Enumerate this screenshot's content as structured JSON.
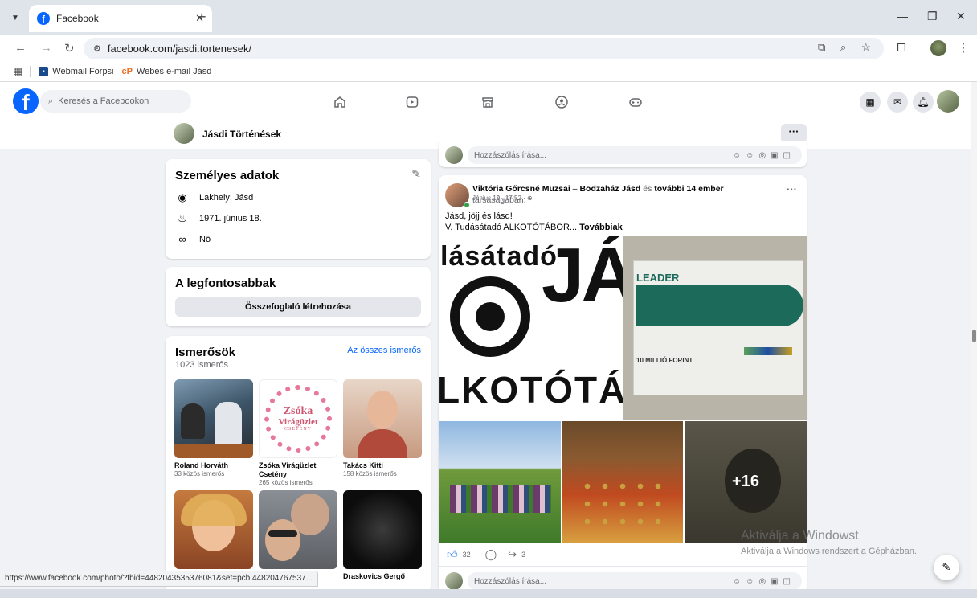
{
  "browser": {
    "tab_title": "Facebook",
    "url": "facebook.com/jasdi.tortenesek/",
    "bookmarks": [
      {
        "label": "Webmail Forpsi"
      },
      {
        "label": "Webes e-mail Jásd"
      }
    ],
    "status_url": "https://www.facebook.com/photo/?fbid=448204353537608​1&set=pcb.448204767537..."
  },
  "fb": {
    "search_placeholder": "Keresés a Facebookon"
  },
  "page": {
    "name": "Jásdi Történések"
  },
  "about": {
    "title": "Személyes adatok",
    "residence": "Lakhely: Jásd",
    "birthday": "1971. június 18.",
    "gender": "Nő"
  },
  "featured": {
    "title": "A legfontosabbak",
    "button": "Összefoglaló létrehozása"
  },
  "friends": {
    "title": "Ismerősök",
    "count": "1023 ismerős",
    "see_all": "Az összes ismerős",
    "items": [
      {
        "name": "Roland Horváth",
        "mutual": "33 közös ismerős"
      },
      {
        "name": "Zsóka Virágüzlet Csetény",
        "mutual": "265 közös ismerős"
      },
      {
        "name": "Takács Kitti",
        "mutual": "158 közös ismerős"
      },
      {
        "name": "",
        "mutual": ""
      },
      {
        "name": "",
        "mutual": ""
      },
      {
        "name": "Draskovics Gergő",
        "mutual": ""
      }
    ],
    "flower_logo_top": "Zsóka",
    "flower_logo_mid": "Virágüzlet",
    "flower_logo_bottom": "CSETÉNY"
  },
  "post": {
    "author": "Viktória Gőrcsné Muzsai",
    "with_sep": " – ",
    "with_page": "Bodzaház Jásd",
    "and_text": " és ",
    "others": "további 14 ember",
    "suffix": " társaságában.",
    "time": "Június 19., 17:52 · ",
    "line1": "Jásd, jöjj és lásd!",
    "line2": "V. Tudásátadó ALKOTÓTÁBOR... ",
    "more": "Továbbiak",
    "poster_top": "lásátadó",
    "poster_big": "JÁS",
    "poster_bottom": "LKOTÓTÁB",
    "leader_title": "LEADER",
    "leader_amount": "10 MILLIÓ FORINT",
    "plus_more": "+16",
    "reactions": "32",
    "shares": "3",
    "comment_placeholder": "Hozzászólás írása..."
  },
  "watermark": {
    "line1": "Aktiválja a Windowst",
    "line2": "Aktiválja a Windows rendszert a Gépházban."
  },
  "colors": {
    "fb_blue": "#0866ff",
    "bg": "#f0f2f5"
  }
}
